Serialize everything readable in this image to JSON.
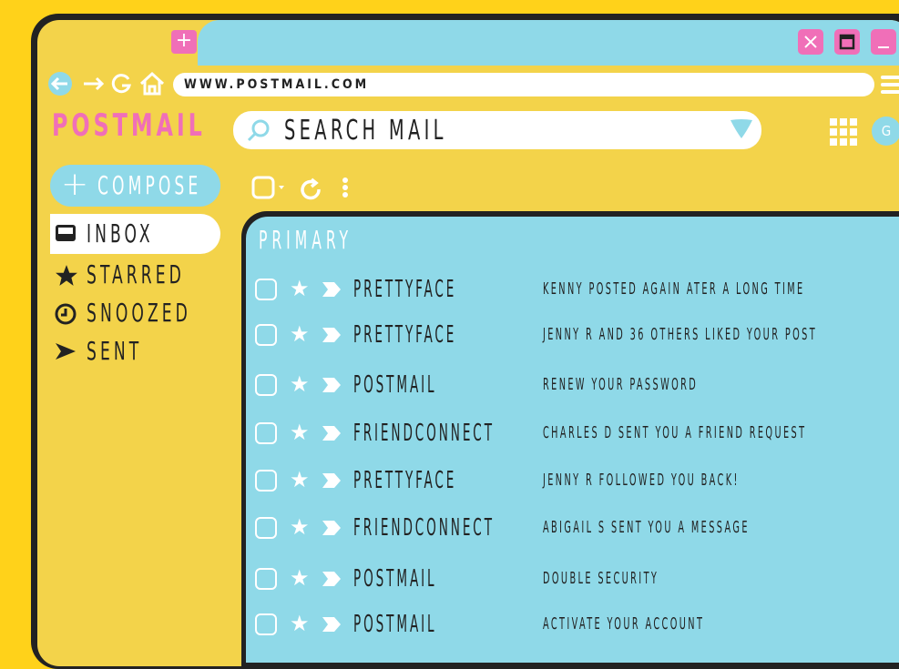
{
  "browser": {
    "url": "WWW.POSTMAIL.COM",
    "new_tab_icon": "plus-icon",
    "window_controls": [
      "close-icon",
      "maximize-icon",
      "minimize-icon"
    ]
  },
  "app": {
    "logo": "POSTMAIL",
    "search_placeholder": "SEARCH MAIL",
    "avatar_initial": "G"
  },
  "sidebar": {
    "compose_label": "COMPOSE",
    "items": [
      {
        "label": "INBOX",
        "icon": "inbox-icon",
        "active": true
      },
      {
        "label": "STARRED",
        "icon": "star-icon",
        "active": false
      },
      {
        "label": "SNOOZED",
        "icon": "clock-icon",
        "active": false
      },
      {
        "label": "SENT",
        "icon": "send-icon",
        "active": false
      }
    ]
  },
  "mail": {
    "tab_label": "PRIMARY",
    "rows": [
      {
        "sender": "PRETTYFACE",
        "subject": "KENNY POSTED AGAIN ATER A LONG TIME"
      },
      {
        "sender": "PRETTYFACE",
        "subject": "JENNY R  AND 36 OTHERS LIKED YOUR POST"
      },
      {
        "sender": "POSTMAIL",
        "subject": "RENEW YOUR PASSWORD"
      },
      {
        "sender": "FRIENDCONNECT",
        "subject": "CHARLES D  SENT YOU A FRIEND REQUEST"
      },
      {
        "sender": "PRETTYFACE",
        "subject": "JENNY R  FOLLOWED YOU BACK!"
      },
      {
        "sender": "FRIENDCONNECT",
        "subject": "ABIGAIL S SENT YOU A MESSAGE"
      },
      {
        "sender": "POSTMAIL",
        "subject": "DOUBLE SECURITY"
      },
      {
        "sender": "POSTMAIL",
        "subject": "ACTIVATE YOUR ACCOUNT"
      }
    ]
  },
  "colors": {
    "background": "#FFD21A",
    "panel": "#F3D34A",
    "accent_blue": "#8FD9E8",
    "accent_pink": "#F06FB8",
    "outline": "#222222"
  }
}
